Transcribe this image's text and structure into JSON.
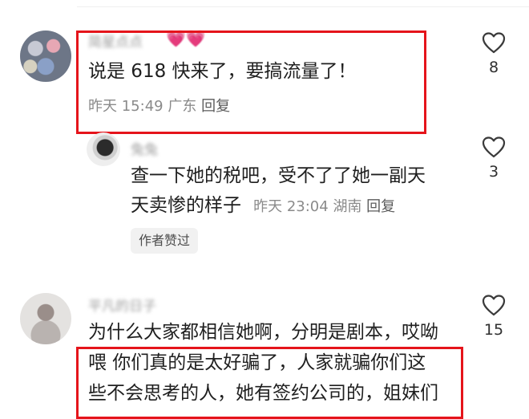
{
  "comments": [
    {
      "author": "简星点点",
      "author_emoji": "💗💗",
      "text": "说是 618 快来了，要搞流量了！",
      "meta": {
        "time": "昨天 15:49",
        "location": "广东",
        "reply_label": "回复"
      },
      "likes": "8",
      "replies": [
        {
          "author": "兔兔",
          "text_lines": [
            "查一下她的税吧，受不了了她一副天",
            "天卖惨的样子"
          ],
          "meta": {
            "time": "昨天 23:04",
            "location": "湖南",
            "reply_label": "回复"
          },
          "badge": "作者赞过",
          "likes": "3"
        }
      ]
    },
    {
      "author": "平凡的日子",
      "text_lines": [
        "为什么大家都相信她啊，分明是剧本，哎呦",
        "喂 你们真的是太好骗了，人家就骗你们这",
        "些不会思考的人，她有签约公司的，姐妹们"
      ],
      "likes": "15"
    }
  ],
  "colors": {
    "highlight_box": "#e5141b",
    "meta_text": "#8a8a8a",
    "badge_bg": "#f1f1f1"
  },
  "icons": {
    "like": "heart-outline-icon"
  }
}
